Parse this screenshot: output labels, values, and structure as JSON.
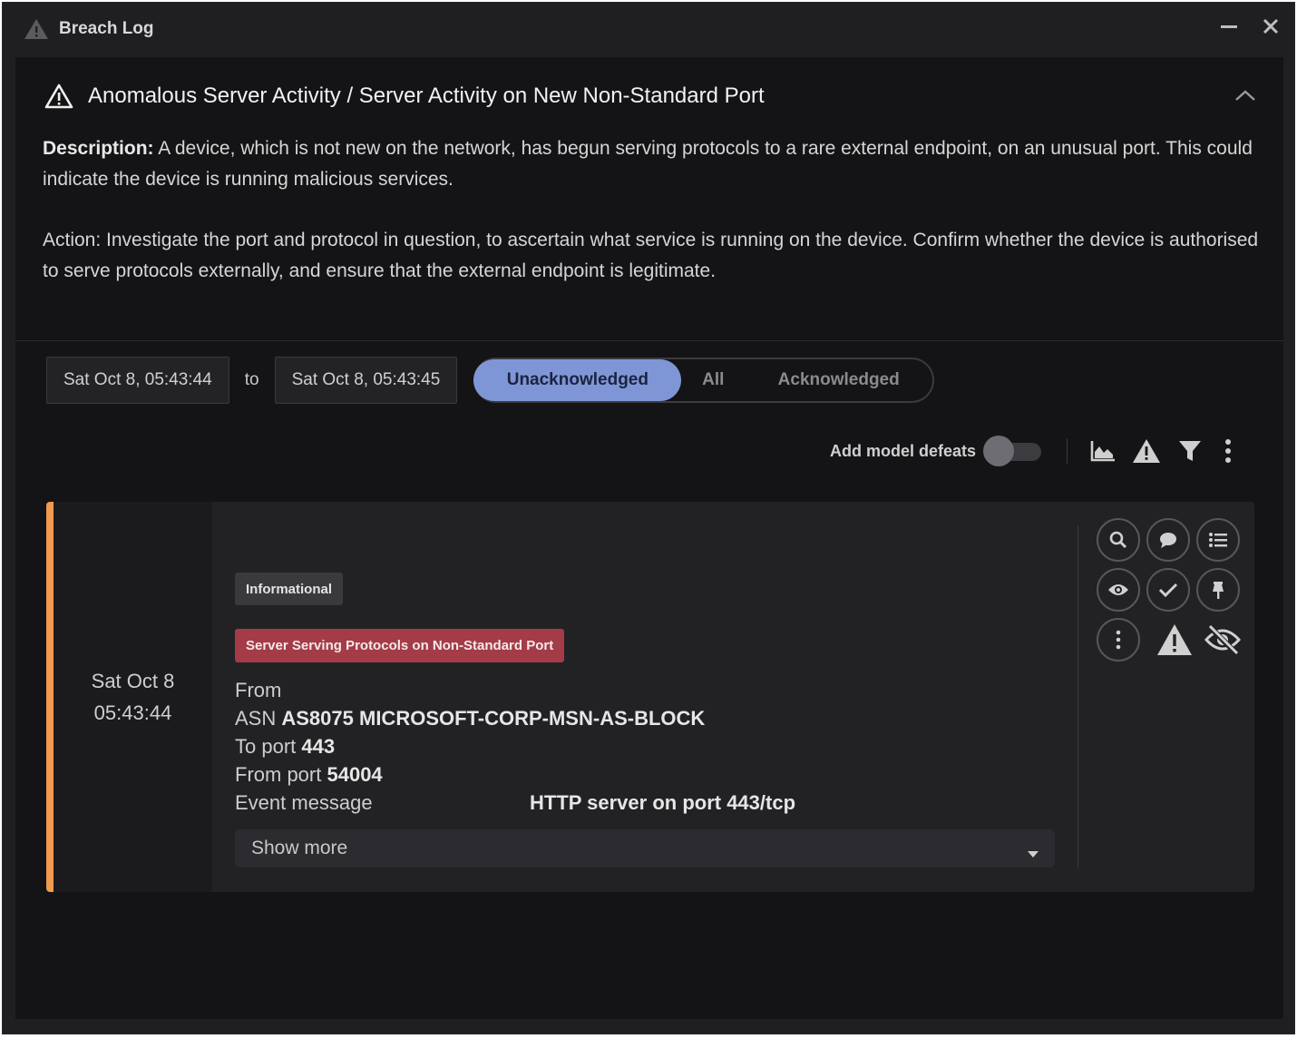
{
  "window": {
    "title": "Breach Log",
    "title_icon": "warning-triangle-icon",
    "controls": [
      "minimize-icon",
      "close-icon"
    ]
  },
  "model": {
    "title": "Anomalous Server Activity / Server Activity on New Non-Standard Port",
    "description_label": "Description:",
    "description_text": " A device, which is not new on the network, has begun serving protocols to a rare external endpoint, on an unusual port. This could indicate the device is running malicious services.",
    "action_text": "Action: Investigate the port and protocol in question, to ascertain what service is running on the device. Confirm whether the device is authorised to serve protocols externally, and ensure that the external endpoint is legitimate."
  },
  "filters": {
    "date_from": "Sat Oct 8, 05:43:44",
    "to_label": "to",
    "date_to": "Sat Oct 8, 05:43:45",
    "segments": [
      "Unacknowledged",
      "All",
      "Acknowledged"
    ],
    "selected_segment": "Unacknowledged"
  },
  "toolbar": {
    "add_defeats_label": "Add model defeats",
    "add_defeats_enabled": false,
    "icons": [
      "chart-icon",
      "warning-icon",
      "filter-icon",
      "more-vertical-icon"
    ]
  },
  "breach": {
    "accent_color": "#f09b4f",
    "date": "Sat Oct 8",
    "time": "05:43:44",
    "severity_badge": "Informational",
    "model_badge": "Server Serving Protocols on Non-Standard Port",
    "from_label": "From",
    "asn_label": "ASN",
    "asn_value": "AS8075 MICROSOFT-CORP-MSN-AS-BLOCK",
    "to_port_label": "To port",
    "to_port_value": "443",
    "from_port_label": "From port",
    "from_port_value": "54004",
    "event_label": "Event message",
    "event_value": "HTTP server on port 443/tcp",
    "show_more_label": "Show more",
    "actions": [
      "search-icon",
      "comment-icon",
      "list-icon",
      "watch-eye-icon",
      "acknowledge-check-icon",
      "pin-icon",
      "more-vertical-icon",
      "warning-icon",
      "hide-eye-slash-icon"
    ]
  }
}
